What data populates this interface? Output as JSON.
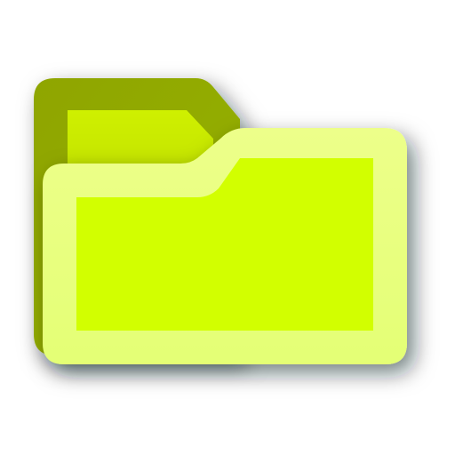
{
  "icon": {
    "name": "folder-icon",
    "colors": {
      "back_tab_dark": "#8EA800",
      "back_tab_mid": "#A7C400",
      "back_inner_light": "#C6EA00",
      "front_border": "#E9FF7F",
      "front_fill": "#D1FF00",
      "shadow": "#0B1B1F"
    }
  }
}
